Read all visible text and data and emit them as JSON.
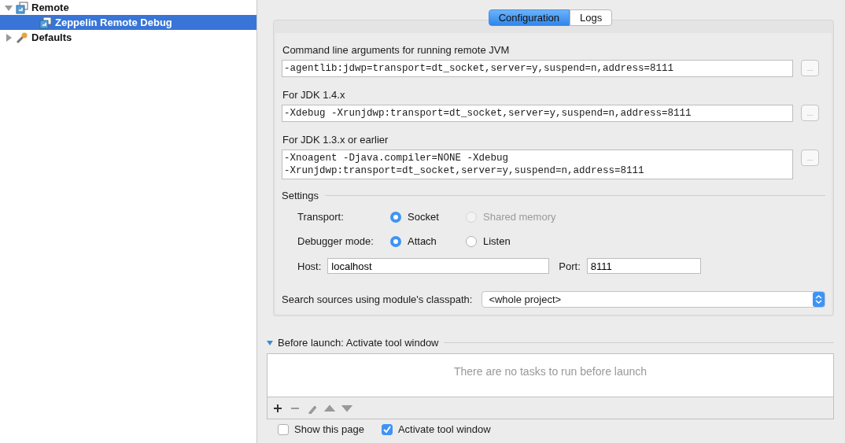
{
  "tree": [
    {
      "label": "Remote",
      "kind": "remote",
      "expanded": true,
      "selected": false,
      "children": [
        {
          "label": "Zeppelin Remote Debug",
          "kind": "remote",
          "selected": true
        }
      ]
    },
    {
      "label": "Defaults",
      "kind": "defaults",
      "expanded": false,
      "selected": false
    }
  ],
  "tabs": [
    {
      "label": "Configuration",
      "selected": true
    },
    {
      "label": "Logs",
      "selected": false
    }
  ],
  "args": [
    {
      "label": "Command line arguments for running remote JVM",
      "value": [
        "-agentlib:jdwp=transport=dt_socket,server=y,suspend=n,address=8111"
      ],
      "button": "..."
    },
    {
      "label": "For JDK 1.4.x",
      "value": [
        "-Xdebug -Xrunjdwp:transport=dt_socket,server=y,suspend=n,address=8111"
      ],
      "button": "..."
    },
    {
      "label": "For JDK 1.3.x or earlier",
      "value": [
        "-Xnoagent -Djava.compiler=NONE -Xdebug",
        "-Xrunjdwp:transport=dt_socket,server=y,suspend=n,address=8111"
      ],
      "button": "..."
    }
  ],
  "settings": {
    "title": "Settings",
    "groups": [
      {
        "label": "Transport:",
        "options": [
          {
            "label": "Socket",
            "selected": true,
            "disabled": false
          },
          {
            "label": "Shared memory",
            "selected": false,
            "disabled": true
          }
        ]
      },
      {
        "label": "Debugger mode:",
        "options": [
          {
            "label": "Attach",
            "selected": true,
            "disabled": false
          },
          {
            "label": "Listen",
            "selected": false,
            "disabled": false
          }
        ]
      }
    ],
    "host": {
      "label": "Host:",
      "value": "localhost"
    },
    "port": {
      "label": "Port:",
      "value": "8111"
    }
  },
  "classpath": {
    "label": "Search sources using module's classpath:",
    "value": "<whole project>"
  },
  "before_launch": {
    "title": "Before launch: Activate tool window",
    "expanded": true,
    "empty_text": "There are no tasks to run before launch",
    "tools": [
      {
        "kind": "add",
        "disabled": false
      },
      {
        "kind": "remove",
        "disabled": true
      },
      {
        "kind": "edit",
        "disabled": true
      },
      {
        "kind": "up",
        "disabled": true
      },
      {
        "kind": "down",
        "disabled": true
      }
    ]
  },
  "checkboxes": [
    {
      "label": "Show this page",
      "checked": false
    },
    {
      "label": "Activate tool window",
      "checked": true
    }
  ]
}
